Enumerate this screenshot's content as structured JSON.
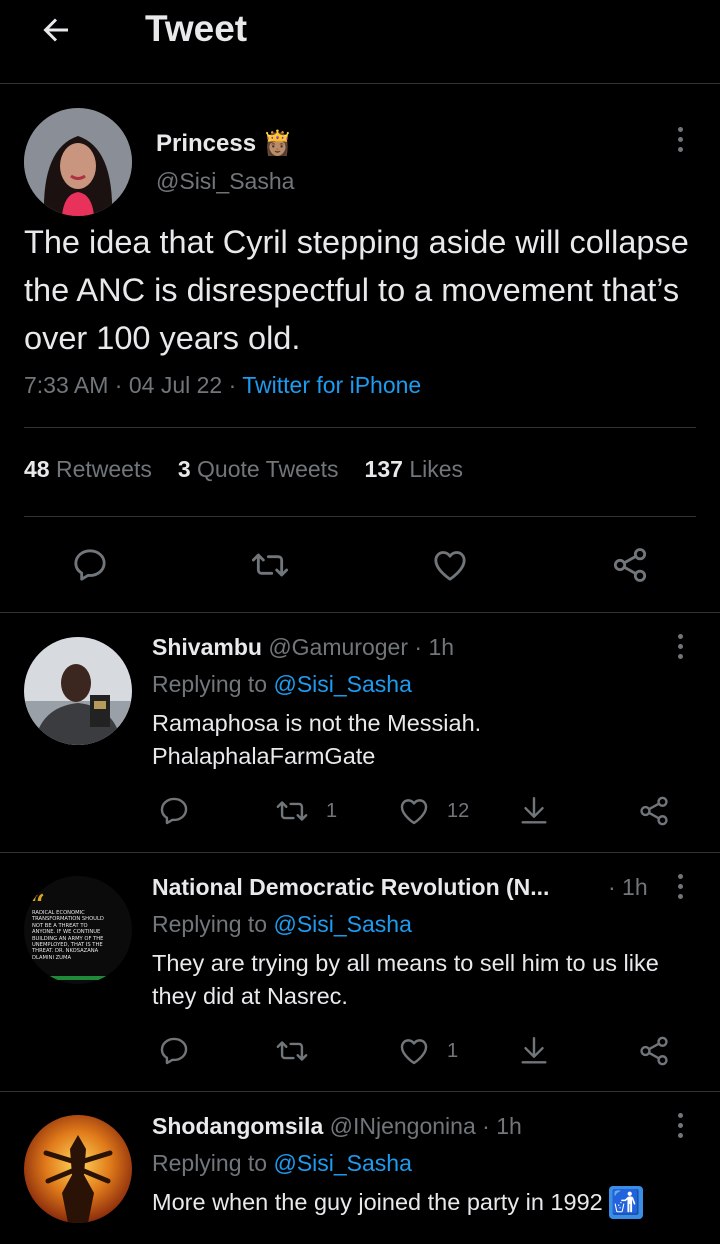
{
  "header": {
    "title": "Tweet",
    "back_icon": "arrow-left-icon"
  },
  "main_tweet": {
    "display_name": "Princess",
    "name_emoji": "👸🏽",
    "handle": "@Sisi_Sasha",
    "text": "The idea that Cyril stepping aside will collapse the ANC is disrespectful to a movement that’s over 100 years old.",
    "time": "7:33 AM",
    "date": "04 Jul 22",
    "source": "Twitter for iPhone",
    "sep": "·",
    "retweets_count": "48",
    "retweets_label": "Retweets",
    "quotes_count": "3",
    "quotes_label": "Quote Tweets",
    "likes_count": "137",
    "likes_label": "Likes"
  },
  "replies": [
    {
      "display_name": "Shivambu",
      "handle": "@Gamuroger",
      "time": "· 1h",
      "replying_prefix": "Replying to",
      "replying_handle": "@Sisi_Sasha",
      "text": "Ramaphosa is not the Messiah. PhalaphalaFarmGate",
      "retweets": "1",
      "likes": "12"
    },
    {
      "display_name": "National Democratic Revolution (N...",
      "handle": "",
      "time": "· 1h",
      "replying_prefix": "Replying to",
      "replying_handle": "@Sisi_Sasha",
      "text": "They are trying by all means to sell him to us like they did at Nasrec.",
      "retweets": "",
      "likes": "1",
      "avatar_text": "RADICAL ECONOMIC TRANSFORMATION SHOULD NOT BE A THREAT TO ANYONE. IF WE CONTINUE BUILDING AN ARMY OF THE UNEMPLOYED, THAT IS THE THREAT. DR. NKOSAZANA DLAMINI ZUMA",
      "avatar_quote": "“"
    },
    {
      "display_name": "Shodangomsila",
      "handle": "@INjengonina",
      "time": "· 1h",
      "replying_prefix": "Replying to",
      "replying_handle": "@Sisi_Sasha",
      "text": "More when the guy joined the party in 1992",
      "emoji": "🚮"
    }
  ],
  "colors": {
    "background": "#000000",
    "text": "#e7e9ea",
    "muted": "#71767b",
    "link": "#1d9bf0",
    "divider": "#2f3336"
  }
}
